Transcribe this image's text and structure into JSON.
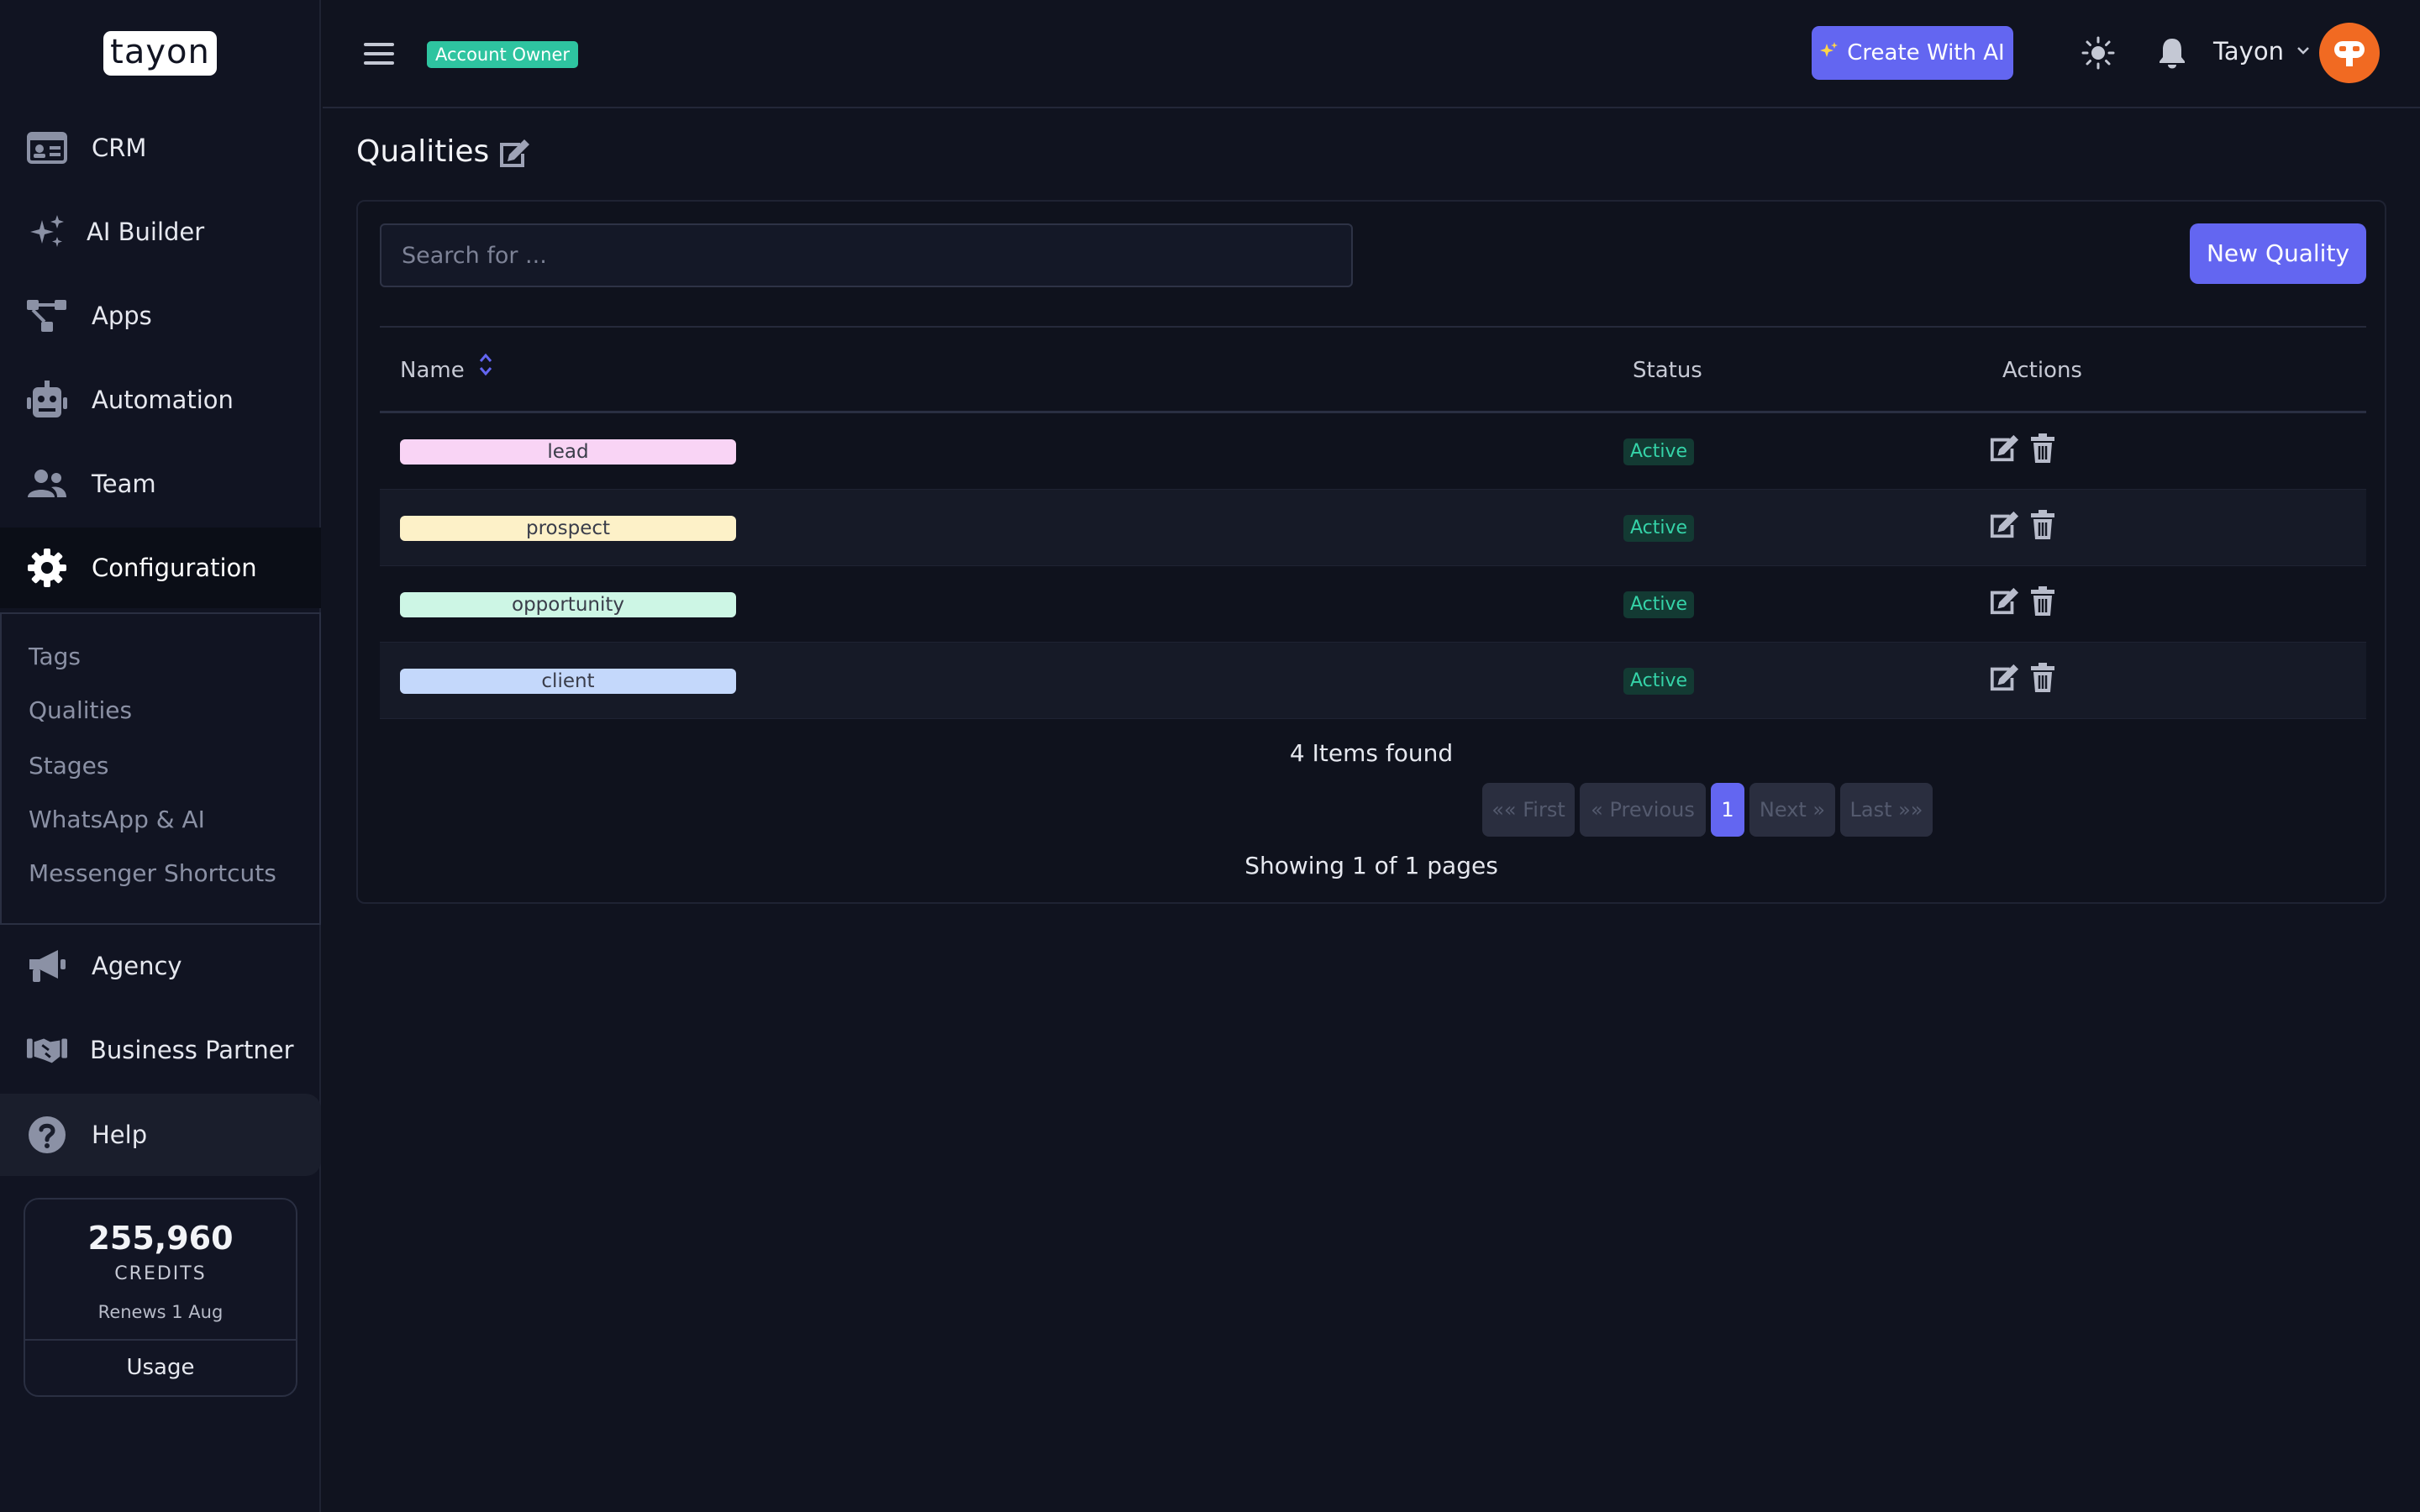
{
  "brand": {
    "logo_text": "tayon"
  },
  "sidebar": {
    "items": [
      {
        "label": "CRM",
        "icon": "id-card-icon"
      },
      {
        "label": "AI Builder",
        "icon": "sparkles-icon"
      },
      {
        "label": "Apps",
        "icon": "flow-icon"
      },
      {
        "label": "Automation",
        "icon": "robot-icon"
      },
      {
        "label": "Team",
        "icon": "users-icon"
      },
      {
        "label": "Configuration",
        "icon": "gear-icon",
        "active": true
      },
      {
        "label": "Agency",
        "icon": "megaphone-icon"
      },
      {
        "label": "Business Partner",
        "icon": "handshake-icon"
      },
      {
        "label": "Help",
        "icon": "question-circle-icon"
      }
    ],
    "submenu": [
      "Tags",
      "Qualities",
      "Stages",
      "WhatsApp & AI",
      "Messenger Shortcuts"
    ],
    "credits": {
      "amount": "255,960",
      "unit": "CREDITS",
      "renews": "Renews 1 Aug",
      "usage_label": "Usage"
    }
  },
  "topbar": {
    "role_badge": "Account Owner",
    "create_ai_label": "Create With AI",
    "user_name": "Tayon",
    "icons": [
      "menu-icon",
      "sparkle-icon",
      "sun-icon",
      "bell-icon",
      "chevron-down-icon",
      "robot-avatar-icon"
    ]
  },
  "page": {
    "title": "Qualities",
    "search_placeholder": "Search for ...",
    "new_button": "New Quality",
    "columns": {
      "name": "Name",
      "status": "Status",
      "actions": "Actions"
    },
    "rows": [
      {
        "name": "lead",
        "color": "#f9d4f5",
        "status": "Active"
      },
      {
        "name": "prospect",
        "color": "#fdf1c8",
        "status": "Active"
      },
      {
        "name": "opportunity",
        "color": "#cdf6e5",
        "status": "Active"
      },
      {
        "name": "client",
        "color": "#c4d8fb",
        "status": "Active"
      }
    ],
    "items_found": "4 Items found",
    "pagination": {
      "first": "«« First",
      "previous": "« Previous",
      "current": "1",
      "next": "Next »",
      "last": "Last »»"
    },
    "showing": "Showing 1 of 1 pages"
  },
  "colors": {
    "background": "#10131f",
    "accent": "#6366f1",
    "success": "#35d3a8",
    "owner_badge": "#2ec4a0",
    "avatar": "#f16a22"
  }
}
